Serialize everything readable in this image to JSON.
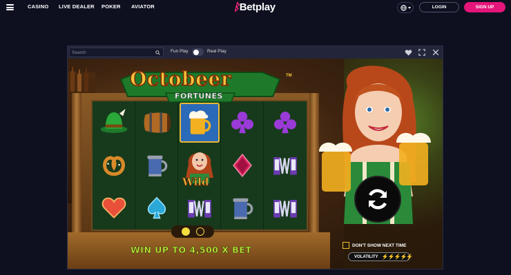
{
  "nav": {
    "links": [
      "CASINO",
      "LIVE DEALER",
      "POKER",
      "AVIATOR"
    ],
    "logo": "Betplay",
    "login_label": "LOGIN",
    "signup_label": "SIGN UP"
  },
  "game_bar": {
    "search_placeholder": "Search",
    "fun_play_label": "Fun Play",
    "real_play_label": "Real Play",
    "fun_play_on": true
  },
  "game": {
    "title": "Octobeer",
    "title_tm": "TM",
    "subtitle": "FORTUNES",
    "win_text": "WIN UP TO 4,500 X BET",
    "wild_label": "Wild",
    "dont_show_label": "DON'T SHOW NEXT TIME",
    "volatility_label": "VOLATILITY",
    "volatility_level": 5,
    "page_dots": 2,
    "active_dot": 0,
    "reel_symbols": [
      [
        "hat-icon",
        "pretzel-icon",
        "heart-icon"
      ],
      [
        "barrel-icon",
        "stein-icon",
        "spade-icon"
      ],
      [
        "beer-mug-icon",
        "wild-girl-icon",
        "accordion-icon"
      ],
      [
        "club-icon",
        "diamond-icon",
        "stein-icon"
      ],
      [
        "club-icon",
        "accordion-icon",
        "accordion-icon"
      ]
    ]
  },
  "colors": {
    "accent": "#e5157a",
    "title_gold": "#f6c53a",
    "win_green": "#c8f03a",
    "volatility_bolt": "#f5b400"
  }
}
